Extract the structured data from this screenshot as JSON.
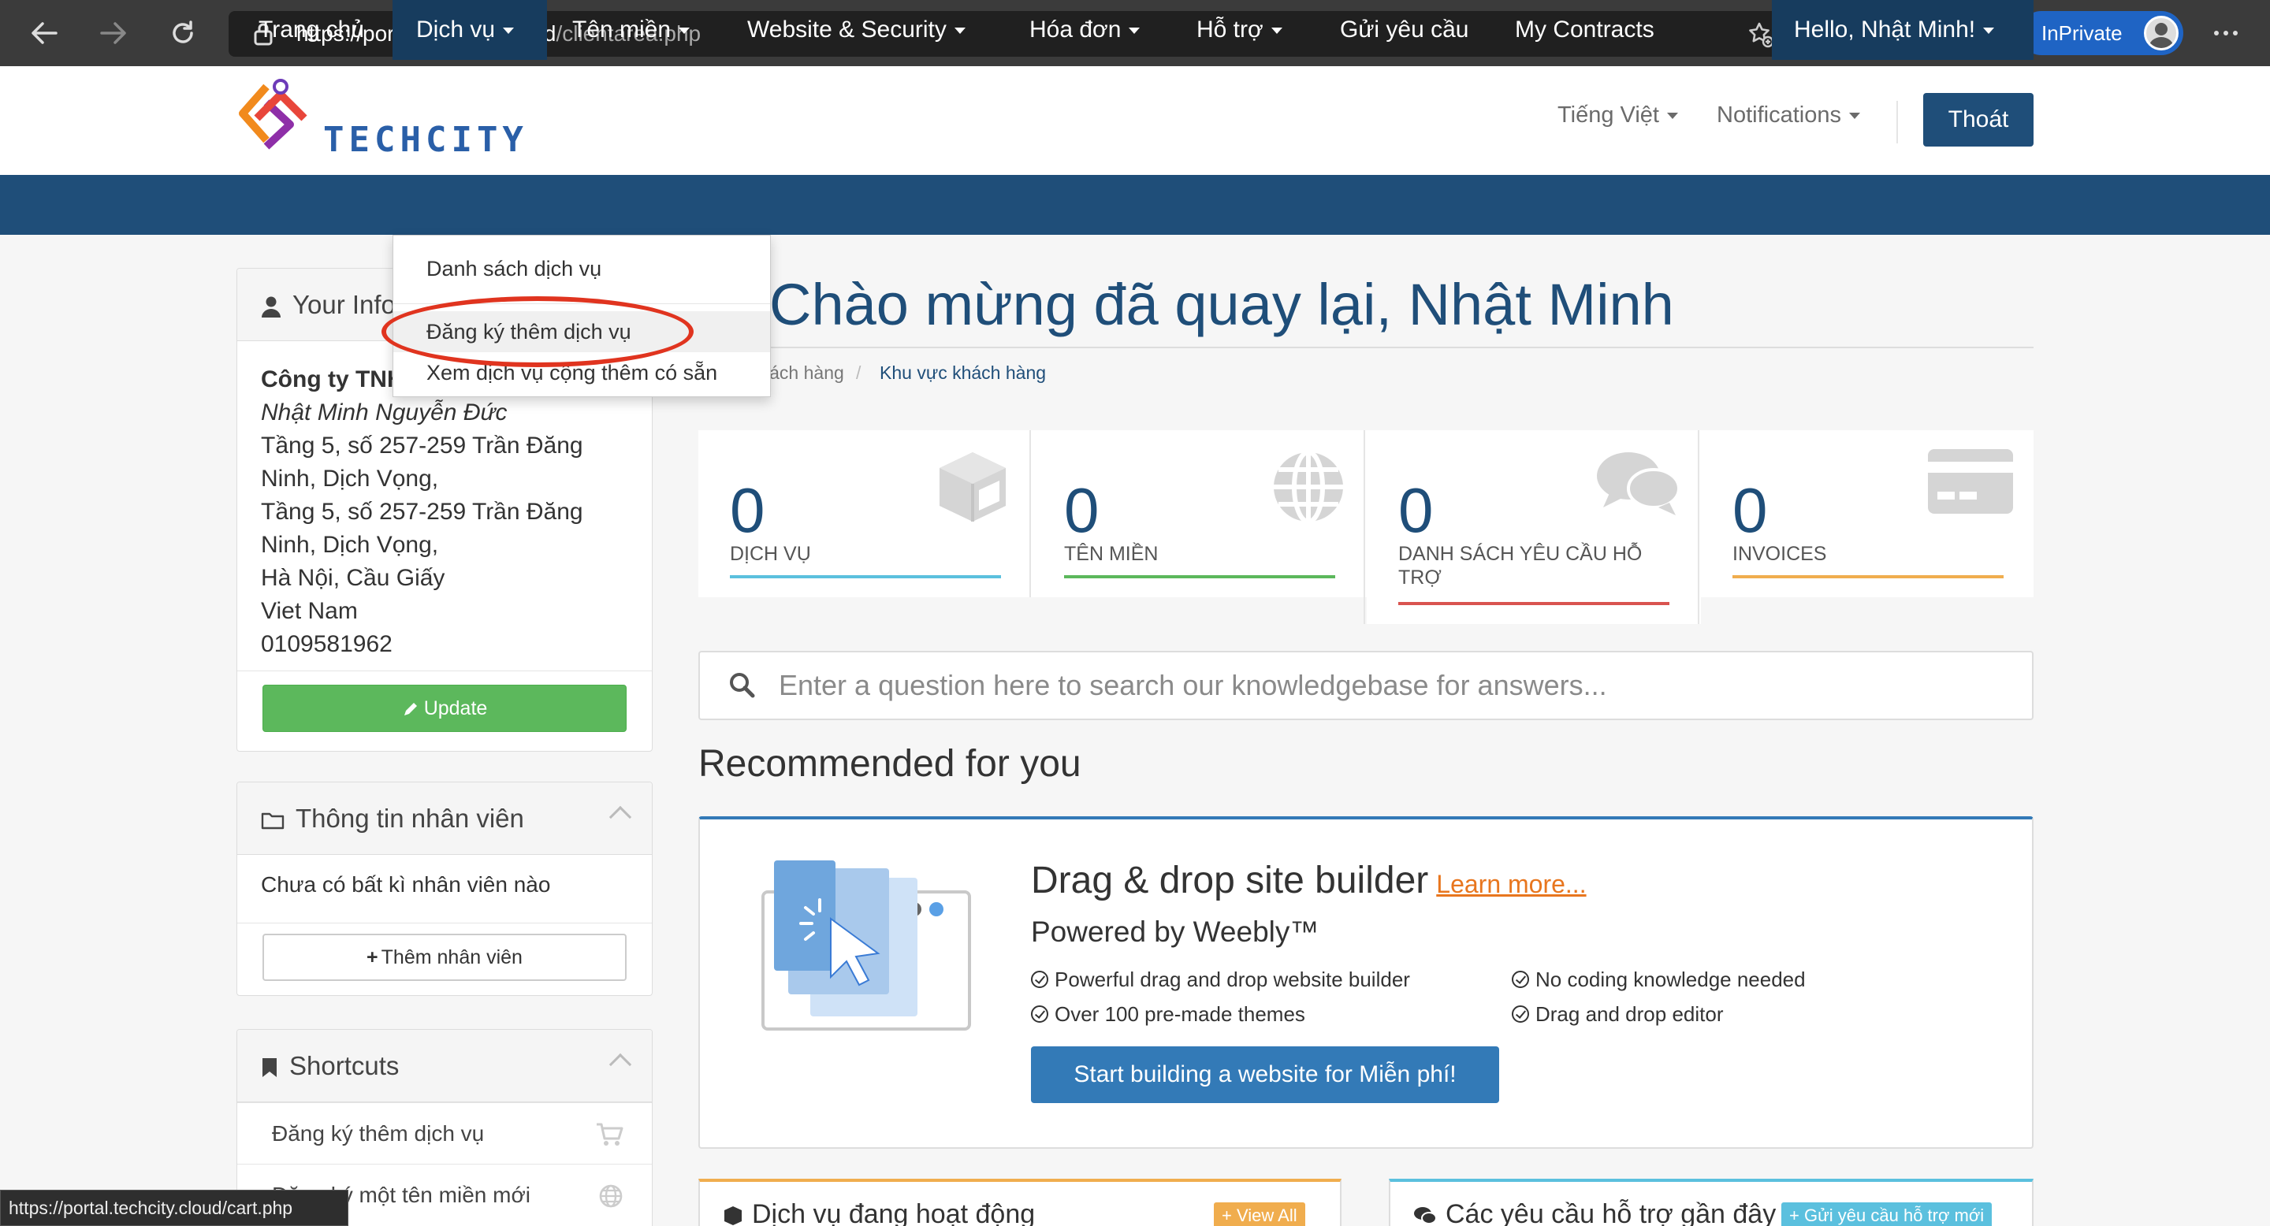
{
  "browser": {
    "url_main": "https://portal.techcity.cloud",
    "url_rest": "/clientarea.php",
    "inprivate_label": "InPrivate",
    "status_url": "https://portal.techcity.cloud/cart.php"
  },
  "header": {
    "logo_text": "TECHCITY",
    "language": "Tiếng Việt",
    "notifications": "Notifications",
    "logout": "Thoát"
  },
  "nav": {
    "items": [
      "Trang chủ",
      "Dịch vụ",
      "Tên miền",
      "Website & Security",
      "Hóa đơn",
      "Hỗ trợ",
      "Gửi yêu cầu",
      "My Contracts"
    ],
    "user": "Hello, Nhật Minh!"
  },
  "dropdown": {
    "items": [
      "Danh sách dịch vụ",
      "Đăng ký thêm dịch vụ",
      "Xem dịch vụ cộng thêm có sẵn"
    ]
  },
  "info_panel": {
    "title": "Your Info",
    "company": "Công ty TNHH",
    "name": "Nhật Minh Nguyễn Đức",
    "address_lines": [
      "Tầng 5, số 257-259 Trần Đăng",
      "Ninh, Dịch Vọng,",
      "Tầng 5, số 257-259 Trần Đăng",
      "Ninh, Dịch Vọng,",
      "Hà Nội, Cầu Giấy",
      "Viet Nam",
      "0109581962"
    ],
    "update_button": "Update"
  },
  "staff_panel": {
    "title": "Thông tin nhân viên",
    "empty_text": "Chưa có bất kì nhân viên nào",
    "add_button": "Thêm nhân viên"
  },
  "shortcuts_panel": {
    "title": "Shortcuts",
    "items": [
      "Đăng ký thêm dịch vụ",
      "Đăng ký một tên miền mới"
    ]
  },
  "main": {
    "welcome": "Chào mừng đã quay lại, Nhật Minh",
    "breadcrumb": [
      "Khách hàng",
      "Khu vực khách hàng"
    ],
    "tiles": [
      {
        "value": "0",
        "label": "DỊCH VỤ"
      },
      {
        "value": "0",
        "label": "TÊN MIỀN"
      },
      {
        "value": "0",
        "label": "DANH SÁCH YÊU CẦU HỖ TRỢ"
      },
      {
        "value": "0",
        "label": "INVOICES"
      }
    ],
    "kb_placeholder": "Enter a question here to search our knowledgebase for answers...",
    "recommended_title": "Recommended for you"
  },
  "recommend": {
    "heading": "Drag & drop site builder",
    "learn_more": "Learn more...",
    "powered": "Powered by Weebly™",
    "features": [
      "Powerful drag and drop website builder",
      "No coding knowledge needed",
      "Over 100 pre-made themes",
      "Drag and drop editor"
    ],
    "button": "Start building a website for Miễn phí!"
  },
  "bottom": {
    "active_services": "Dịch vụ đang hoạt động",
    "view_all": "+ View All",
    "recent_tickets": "Các yêu cầu hỗ trợ gần đây",
    "new_ticket": "+ Gửi yêu cầu hỗ trợ mới"
  },
  "colors": {
    "brand_blue": "#1f4e79",
    "accent_blue": "#337ab7",
    "green": "#5cb85c",
    "highlight_red": "#e0341f"
  }
}
